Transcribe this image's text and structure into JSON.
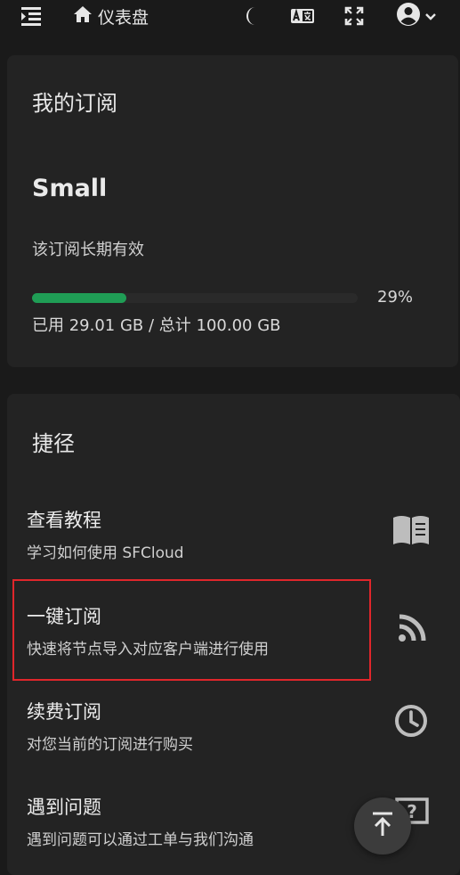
{
  "header": {
    "home_label": "仪表盘",
    "icons": [
      "menu-icon",
      "home-icon",
      "moon-icon",
      "translate-icon",
      "fullscreen-icon",
      "account-icon",
      "chevron-down-icon"
    ]
  },
  "subscription": {
    "title": "我的订阅",
    "plan_name": "Small",
    "validity": "该订阅长期有效",
    "usage_percent": 29,
    "usage_percent_label": "29%",
    "usage_text": "已用 29.01 GB / 总计 100.00 GB",
    "accent_color": "#1f9d55"
  },
  "shortcuts": {
    "title": "捷径",
    "items": [
      {
        "label": "查看教程",
        "desc": "学习如何使用 SFCloud",
        "icon": "book-icon"
      },
      {
        "label": "一键订阅",
        "desc": "快速将节点导入对应客户端进行使用",
        "icon": "rss-icon"
      },
      {
        "label": "续费订阅",
        "desc": "对您当前的订阅进行购买",
        "icon": "clock-icon"
      },
      {
        "label": "遇到问题",
        "desc": "遇到问题可以通过工单与我们沟通",
        "icon": "help-chat-icon"
      }
    ]
  },
  "fab": {
    "icon": "arrow-up-to-top-icon"
  },
  "highlight_color": "#e0262b"
}
